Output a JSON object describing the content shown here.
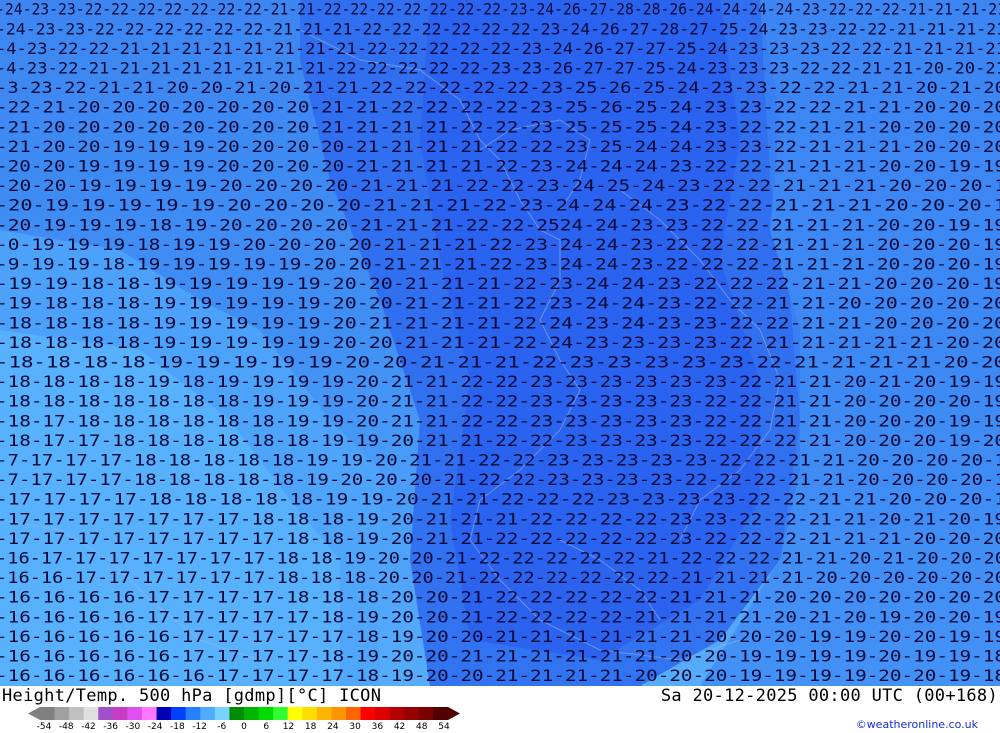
{
  "map": {
    "region": "Europe / North Atlantic",
    "fill_colors": {
      "deep": "#1e64f0",
      "medium": "#3c96ff",
      "light": "#50a9f9",
      "lighter": "#5fb8ff"
    },
    "contour_rows": [
      "-24-23-23-22-22-22-22-22-22-22-21-21-22-22-22-22-22-22-22-23-24-26-27-28-28-26-24-24-24-24-23-22-22-22-21-21-21-21",
      "-24-23-23-22-22-22-22-22-22-21-21-21-22-22-22-22-22-22-23-24-26-27-28-27-25-24-23-23-22-22-21-21-21-21",
      "-4-23-22-22-21-21-21-21-21-21-21-21-22-22-22-22-22-23-24-26-27-27-25-24-23-23-23-22-22-21-21-21-21",
      "-4-23-22-21-21-21-21-21-21-21-21-22-22-22-22-22-23-23-26-27-27-25-24-23-23-23-22-22-21-21-20-20-21",
      "-3-23-22-21-21-20-20-21-20-21-21-22-22-22-22-22-23-25-26-25-24-23-23-22-22-21-21-20-21-20",
      "-22-21-20-20-20-20-20-20-20-21-21-22-22-22-22-23-25-26-25-24-23-23-22-22-21-21-20-20-20",
      "-21-20-20-20-20-20-20-20-20-21-21-21-21-22-22-23-25-25-25-24-23-22-22-21-21-20-20-20-20",
      "-21-20-20-19-19-19-20-20-20-20-21-21-21-21-22-22-23-25-24-24-23-23-22-21-21-21-20-20-20",
      "-20-20-19-19-19-19-20-20-20-20-21-21-21-21-22-23-24-24-24-23-22-22-21-21-21-20-20-19-19",
      "-20-20-19-19-19-19-20-20-20-20-21-21-21-22-22-23-24-25-24-23-22-22-21-21-21-20-20-20-1",
      "-20-19-19-19-19-19-20-20-20-20-21-21-21-22-23-24-24-24-23-22-22-21-21-21-20-20-20-1",
      "-20-19-19-19-18-19-20-20-20-20-21-21-21-22-22-2524-24-23-23-22-22-21-21-21-20-20-19-19",
      "-0-19-19-19-18-19-19-20-20-20-20-21-21-21-22-23-24-24-23-22-22-22-21-21-21-20-20-20-19",
      "-9-19-19-18-19-19-19-19-19-20-20-21-21-21-22-23-24-24-23-22-22-22-21-21-21-20-20-20-19",
      "-19-19-18-18-19-19-19-19-19-20-20-21-21-21-22-23-24-24-23-22-22-22-21-21-20-20-20-19",
      "-19-18-18-18-19-19-19-19-19-20-20-21-21-21-22-23-24-24-23-22-22-21-21-20-20-20-20-20",
      "-18-18-18-18-19-19-19-19-19-20-21-21-21-21-22-24-23-24-23-23-22-22-21-21-20-20-20-20",
      "-18-18-18-18-19-19-19-19-19-20-20-21-21-21-22-24-23-23-23-23-22-21-21-21-21-21-20-20",
      "-18-18-18-18-19-19-19-19-19-20-20-21-21-21-22-23-23-23-23-23-22-21-21-21-21-20-20",
      "-18-18-18-18-19-18-19-19-19-19-20-21-21-22-22-23-23-23-23-23-23-22-21-21-20-21-20-19-19",
      "-18-18-18-18-18-18-18-19-19-19-20-21-21-22-22-23-23-23-23-23-22-22-21-21-20-20-20-20-19",
      "-18-17-18-18-18-18-18-18-19-19-20-21-21-22-22-23-23-23-23-23-22-22-21-21-20-20-20-19-19",
      "-18-17-17-18-18-18-18-18-18-19-19-20-21-21-22-22-23-23-23-23-22-22-22-21-20-20-20-19-20",
      "-7-17-17-17-18-18-18-18-18-19-19-20-21-21-22-22-23-23-23-23-23-22-22-21-21-20-20-20-20-1",
      "-7-17-17-17-18-18-18-18-18-19-20-20-20-21-22-22-23-23-23-23-22-22-22-21-21-20-20-20-20-1",
      "-17-17-17-17-18-18-18-18-18-19-19-20-21-21-22-22-22-23-23-23-23-22-22-21-21-20-20-20-1",
      "-17-17-17-17-17-17-17-18-18-18-19-20-21-21-21-22-22-22-22-23-23-22-22-21-21-20-21-20-19",
      "-17-17-17-17-17-17-17-17-18-18-19-20-21-21-22-22-22-22-22-23-22-22-22-21-21-21-20-20-20",
      "-16-17-17-17-17-17-17-17-18-18-19-20-20-21-22-22-22-22-22-21-22-22-22-21-21-20-21-20-20-20",
      "-16-16-17-17-17-17-17-17-18-18-18-20-20-21-22-22-22-22-22-22-21-21-21-21-20-20-20-20-20-20",
      "-16-16-16-16-17-17-17-17-18-18-18-20-20-21-22-22-22-22-22-21-21-21-20-20-20-20-20-20-20",
      "-16-16-16-16-17-17-17-17-17-18-19-20-20-21-22-22-22-22-21-21-21-21-20-21-20-19-20-20-19",
      "-16-16-16-16-16-17-17-17-17-17-18-19-20-20-21-21-21-21-21-21-20-20-20-19-19-20-20-19-19",
      "-16-16-16-16-16-17-17-17-17-18-19-20-20-21-21-21-21-21-21-20-20-19-19-19-19-20-19-19-18",
      "-16-16-16-16-16-16-17-17-17-17-18-19-20-20-21-21-21-21-20-20-20-19-19-19-19-20-20-19-18"
    ]
  },
  "footer": {
    "title": "Height/Temp. 500 hPa [gdmp][°C] ICON",
    "datetime": "Sa 20-12-2025 00:00 UTC (00+168)",
    "credit": "©weatheronline.co.uk"
  },
  "legend": {
    "ticks": [
      "-54",
      "-48",
      "-42",
      "-36",
      "-30",
      "-24",
      "-18",
      "-12",
      "-6",
      "0",
      "6",
      "12",
      "18",
      "24",
      "30",
      "36",
      "42",
      "48",
      "54"
    ],
    "colors": [
      "#808080",
      "#a0a0a0",
      "#c0c0c0",
      "#e0e0e0",
      "#a050c8",
      "#c83cc8",
      "#e050f0",
      "#ff78ff",
      "#0000b4",
      "#0040ff",
      "#2880ff",
      "#50aaff",
      "#78d2ff",
      "#008c00",
      "#00b400",
      "#00dc00",
      "#32ff32",
      "#ffff00",
      "#ffdc00",
      "#ffb400",
      "#ff9600",
      "#ff6400",
      "#ff0000",
      "#dc0000",
      "#b40000",
      "#960000",
      "#780000",
      "#500000"
    ]
  }
}
